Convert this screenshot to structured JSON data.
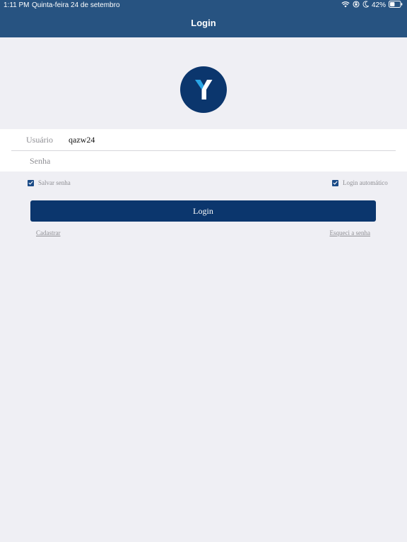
{
  "status_bar": {
    "time": "1:11 PM",
    "date": "Quinta-feira 24 de setembro",
    "battery": "42%",
    "icons": [
      "wifi-icon",
      "orientation-lock-icon",
      "moon-icon",
      "battery-icon"
    ]
  },
  "nav": {
    "title": "Login"
  },
  "logo": {
    "icon": "y-logo-icon",
    "circle_color": "#0b366d",
    "accent_color": "#2aa6e6"
  },
  "form": {
    "username_label": "Usuário",
    "username_value": "qazw24",
    "password_label": "Senha",
    "password_value": "",
    "save_password_label": "Salvar senha",
    "save_password_checked": true,
    "auto_login_label": "Login automático",
    "auto_login_checked": true,
    "login_button": "Login"
  },
  "links": {
    "register": "Cadastrar",
    "forgot_password": "Esqueci a senha"
  },
  "colors": {
    "header": "#275381",
    "primary": "#0b366d",
    "background": "#efeff4"
  }
}
